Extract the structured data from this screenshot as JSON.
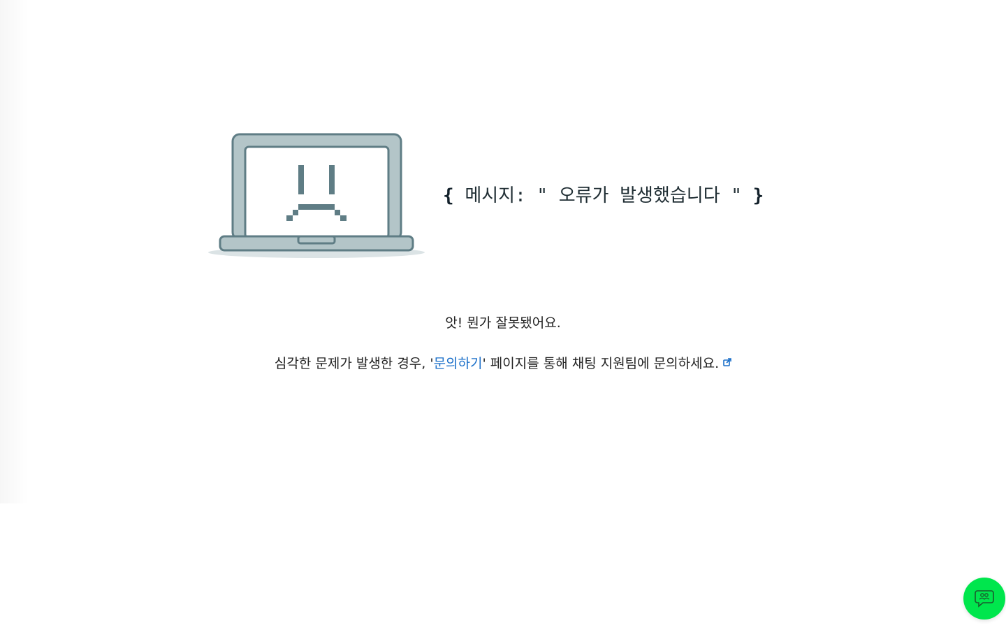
{
  "error": {
    "open_brace": "{",
    "label": "메시지:",
    "quote_open": "\"",
    "text": "오류가 발생했습니다",
    "quote_close": "\"",
    "close_brace": "}"
  },
  "oops_text": "앗! 뭔가 잘못됐어요.",
  "help": {
    "prefix": "심각한 문제가 발생한 경우, '",
    "link": "문의하기",
    "suffix": "' 페이지를 통해 채팅 지원팀에 문의하세요."
  },
  "icons": {
    "illustration": "sad-laptop-icon",
    "external_link": "external-link-icon",
    "chat": "chat-icon"
  },
  "colors": {
    "link": "#1a6fc9",
    "chat_button": "#00e64d",
    "laptop_body": "#b3c5c8",
    "laptop_outline": "#5f7d85"
  }
}
